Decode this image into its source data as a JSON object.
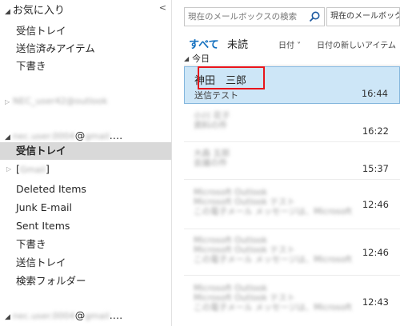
{
  "favorites": {
    "header": "お気に入り",
    "items": [
      "受信トレイ",
      "送信済みアイテム",
      "下書き"
    ]
  },
  "account1": {
    "name": "NEC_user42@outlook"
  },
  "account2": {
    "name_blur": "nec.user.0004",
    "domain_suffix": "@",
    "domain_blur": "gmail",
    "ellipsis": ".…",
    "inbox": "受信トレイ",
    "gmail_folder_open": "[",
    "gmail_folder_blur": "Gmail",
    "gmail_folder_close": "]",
    "folders": [
      "Deleted Items",
      "Junk E-mail",
      "Sent Items",
      "下書き",
      "送信トレイ",
      "検索フォルダー"
    ]
  },
  "account3": {
    "name_blur": "nec.user.0004",
    "domain_suffix": "@",
    "domain_blur": "gmail",
    "ellipsis": ".…"
  },
  "search": {
    "placeholder": "現在のメールボックスの検索",
    "scope": "現在のメールボックス"
  },
  "filters": {
    "all": "すべて",
    "unread": "未読",
    "sort_date": "日付 ˅",
    "sort_order": "日付の新しいアイテム ↓"
  },
  "group": {
    "label": "今日"
  },
  "messages": [
    {
      "sender": "神田　三郎",
      "subject": "送信テスト",
      "time": "16:44"
    },
    {
      "sender": "小川 花子",
      "subject": "資料の件",
      "time": "16:22"
    },
    {
      "sender": "大森 五郎",
      "subject": "会議の件",
      "time": "15:37"
    },
    {
      "sender": "Microsoft Outlook",
      "subject": "Microsoft Outlook テスト",
      "preview": "この電子メール メッセージは、Microsoft",
      "time": "12:46"
    },
    {
      "sender": "Microsoft Outlook",
      "subject": "Microsoft Outlook テスト",
      "preview": "この電子メール メッセージは、Microsoft",
      "time": "12:46"
    },
    {
      "sender": "Microsoft Outlook",
      "subject": "Microsoft Outlook テスト",
      "preview": "この電子メール メッセージは、Microsoft",
      "time": "12:43"
    }
  ],
  "colors": {
    "accent": "#106ebe",
    "selected_row": "#cde6f7",
    "selected_folder": "#d9d9d9",
    "highlight_box": "#e8141b"
  }
}
